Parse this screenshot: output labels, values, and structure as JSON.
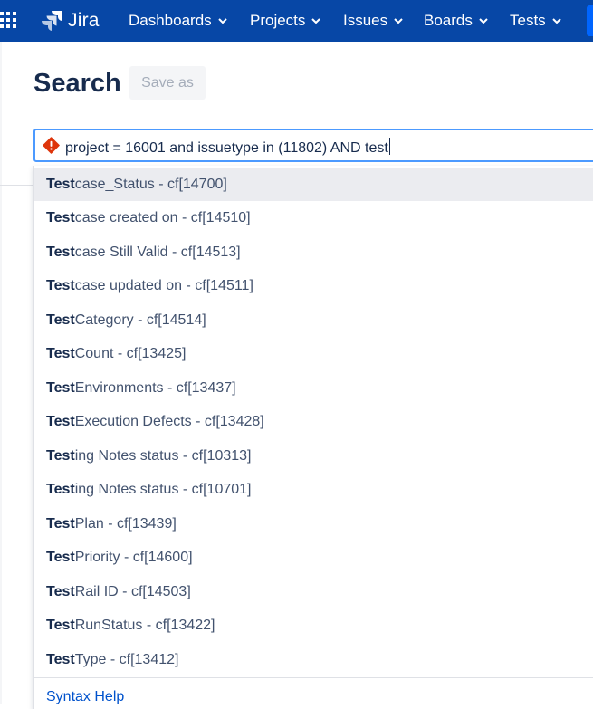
{
  "nav": {
    "logo_text": "Jira",
    "items": [
      {
        "label": "Dashboards"
      },
      {
        "label": "Projects"
      },
      {
        "label": "Issues"
      },
      {
        "label": "Boards"
      },
      {
        "label": "Tests"
      }
    ]
  },
  "page": {
    "title": "Search",
    "save_as_label": "Save as"
  },
  "search": {
    "query": "project = 16001 and issuetype in (11802) AND test"
  },
  "suggestions": [
    {
      "bold": "Test",
      "rest": "case_Status - cf[14700]"
    },
    {
      "bold": "Test",
      "rest": " case created on - cf[14510]"
    },
    {
      "bold": "Test",
      "rest": "case Still Valid - cf[14513]"
    },
    {
      "bold": "Test",
      "rest": " case updated on - cf[14511]"
    },
    {
      "bold": "Test",
      "rest": " Category - cf[14514]"
    },
    {
      "bold": "Test",
      "rest": " Count - cf[13425]"
    },
    {
      "bold": "Test",
      "rest": " Environments - cf[13437]"
    },
    {
      "bold": "Test",
      "rest": " Execution Defects - cf[13428]"
    },
    {
      "bold": "Test",
      "rest": "ing Notes status - cf[10313]"
    },
    {
      "bold": "Test",
      "rest": "ing Notes status - cf[10701]"
    },
    {
      "bold": "Test",
      "rest": " Plan - cf[13439]"
    },
    {
      "bold": "Test",
      "rest": " Priority - cf[14600]"
    },
    {
      "bold": "Test",
      "rest": " Rail ID - cf[14503]"
    },
    {
      "bold": "Test",
      "rest": "RunStatus - cf[13422]"
    },
    {
      "bold": "Test",
      "rest": " Type - cf[13412]"
    }
  ],
  "footer": {
    "syntax_help": "Syntax Help"
  },
  "colors": {
    "topbar": "#0747a6",
    "link": "#0052cc",
    "error": "#de350b",
    "focus": "#4c9aff"
  }
}
